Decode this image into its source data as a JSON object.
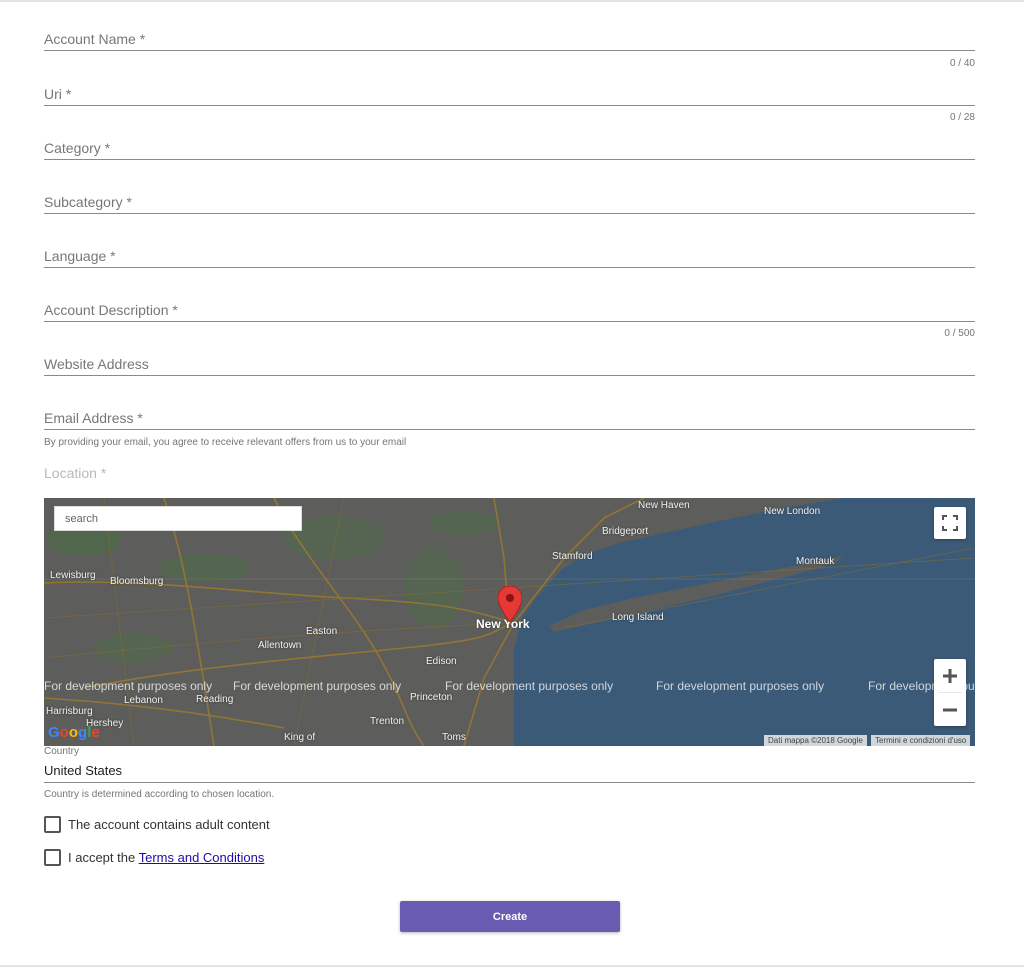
{
  "form": {
    "fields": [
      {
        "label": "Account Name *",
        "counter": "0 / 40"
      },
      {
        "label": "Uri *",
        "counter": "0 / 28"
      },
      {
        "label": "Category *"
      },
      {
        "label": "Subcategory *"
      },
      {
        "label": "Language *"
      },
      {
        "label": "Account Description *",
        "counter": "0 / 500"
      },
      {
        "label": "Website Address"
      },
      {
        "label": "Email Address *",
        "hint": "By providing your email, you agree to receive relevant offers from us to your email"
      }
    ],
    "location_label": "Location *",
    "map": {
      "search_placeholder": "search",
      "watermark": "For development purposes only",
      "attribution_data": "Dati mappa ©2018 Google",
      "attribution_terms": "Termini e condizioni d'uso",
      "logo": "Google",
      "marker_city": "New York",
      "cities": {
        "new_haven": "New Haven",
        "new_london": "New London",
        "bridgeport": "Bridgeport",
        "stamford": "Stamford",
        "montauk": "Montauk",
        "lewisburg": "Lewisburg",
        "bloomsburg": "Bloomsburg",
        "long_island": "Long Island",
        "allentown": "Allentown",
        "easton": "Easton",
        "edison": "Edison",
        "lebanon": "Lebanon",
        "reading": "Reading",
        "harrisburg": "Harrisburg",
        "hershey": "Hershey",
        "princeton": "Princeton",
        "trenton": "Trenton",
        "king_of": "King of",
        "toms": "Toms"
      },
      "colors": {
        "land": "#5d5d5b",
        "water": "#3b5a78",
        "roads": "#9c7a2e",
        "marker": "#e53935"
      }
    },
    "country": {
      "label": "Country",
      "value": "United States",
      "hint": "Country is determined according to chosen location."
    },
    "checkboxes": {
      "adult": "The account contains adult content",
      "accept_prefix": "I accept the",
      "terms_link": "Terms and Conditions"
    },
    "create_label": "Create",
    "accent_color": "#6a5bb2"
  }
}
